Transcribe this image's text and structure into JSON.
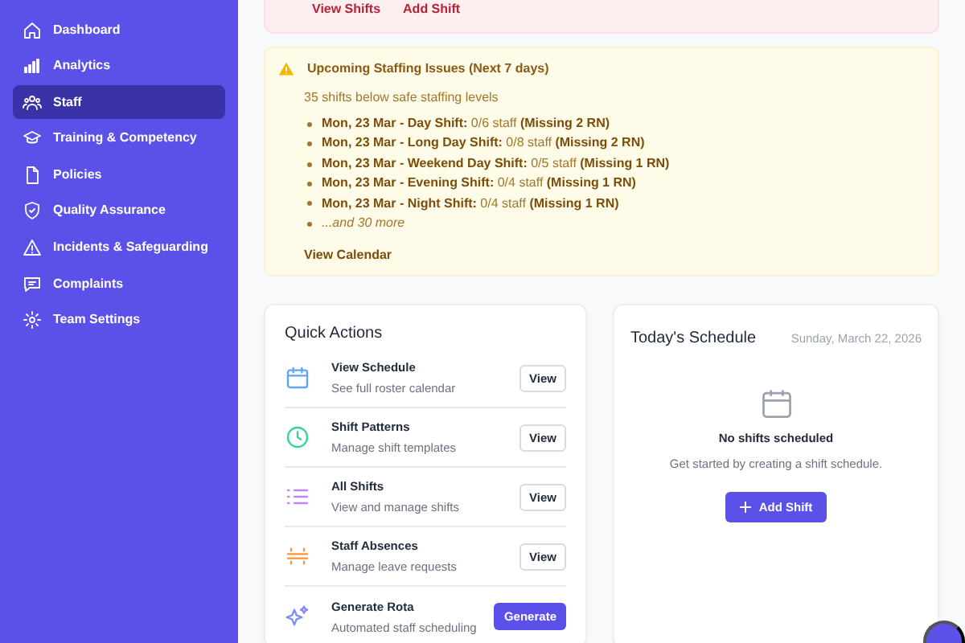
{
  "sidebar": {
    "items": [
      {
        "label": "Dashboard",
        "selected": false
      },
      {
        "label": "Analytics",
        "selected": false
      },
      {
        "label": "Staff",
        "selected": true
      },
      {
        "label": "Training & Competency",
        "selected": false
      },
      {
        "label": "Policies",
        "selected": false
      },
      {
        "label": "Quality Assurance",
        "selected": false
      },
      {
        "label": "Incidents & Safeguarding",
        "selected": false
      },
      {
        "label": "Complaints",
        "selected": false
      },
      {
        "label": "Team Settings",
        "selected": false
      }
    ]
  },
  "danger_alert": {
    "links": [
      "View Shifts",
      "Add Shift"
    ]
  },
  "warning_alert": {
    "title": "Upcoming Staffing Issues (Next 7 days)",
    "subtitle": "35 shifts below safe staffing levels",
    "items": [
      {
        "kind": "shift",
        "text": "**Mon, 23 Mar - Day Shift:** 0/6 staff **(Missing 2 RN)**"
      },
      {
        "kind": "shift",
        "text": "**Mon, 23 Mar - Long Day Shift:** 0/8 staff **(Missing 2 RN)**"
      },
      {
        "kind": "shift",
        "text": "**Mon, 23 Mar - Weekend Day Shift:** 0/5 staff **(Missing 1 RN)**"
      },
      {
        "kind": "shift",
        "text": "**Mon, 23 Mar - Evening Shift:** 0/4 staff **(Missing 1 RN)**"
      },
      {
        "kind": "shift",
        "text": "**Mon, 23 Mar - Night Shift:** 0/4 staff **(Missing 1 RN)**"
      },
      {
        "kind": "more",
        "text": "...and 30 more"
      }
    ],
    "link": "View Calendar"
  },
  "quick_actions": {
    "title": "Quick Actions",
    "items": [
      {
        "title": "View Schedule",
        "subtitle": "See full roster calendar",
        "button": "View",
        "kind": "outline"
      },
      {
        "title": "Shift Patterns",
        "subtitle": "Manage shift templates",
        "button": "View",
        "kind": "outline"
      },
      {
        "title": "All Shifts",
        "subtitle": "View and manage shifts",
        "button": "View",
        "kind": "outline"
      },
      {
        "title": "Staff Absences",
        "subtitle": "Manage leave requests",
        "button": "View",
        "kind": "outline"
      },
      {
        "title": "Generate Rota",
        "subtitle": "Automated staff scheduling",
        "button": "Generate",
        "kind": "primary"
      }
    ]
  },
  "todays_schedule": {
    "title": "Today's Schedule",
    "date": "Sunday, March 22, 2026",
    "empty_title": "No shifts scheduled",
    "empty_text": "Get started by creating a shift schedule.",
    "button": "Add Shift"
  }
}
